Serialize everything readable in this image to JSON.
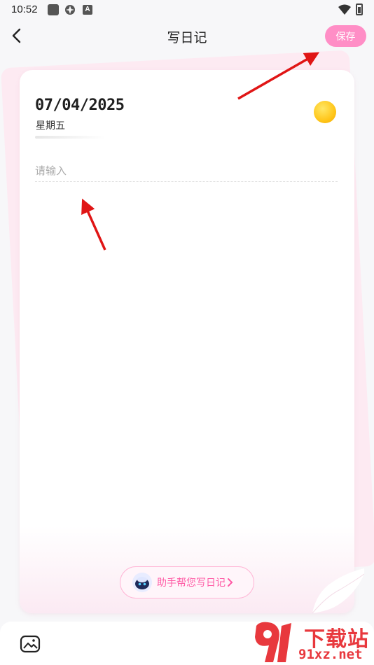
{
  "status_bar": {
    "time": "10:52",
    "icons": [
      "square-app-icon",
      "gear-icon",
      "letter-a-icon",
      "wifi-icon",
      "battery-icon"
    ]
  },
  "header": {
    "title": "写日记",
    "save_label": "保存",
    "back_icon": "chevron-left-icon"
  },
  "diary": {
    "date": "07/04/2025",
    "weekday": "星期五",
    "mood_icon": "yellow-circle-mood-icon",
    "input_placeholder": "请输入",
    "input_value": ""
  },
  "assistant": {
    "label": "助手帮您写日记",
    "icon": "robot-icon"
  },
  "toolbar": {
    "image_icon": "image-icon"
  },
  "watermark": {
    "text": "下载站",
    "domain": "91xz.net"
  },
  "colors": {
    "accent_pink": "#ff8ec6",
    "assistant_text": "#ff5aa5",
    "background": "#f7f7f9",
    "arrow_red": "#e01515"
  }
}
